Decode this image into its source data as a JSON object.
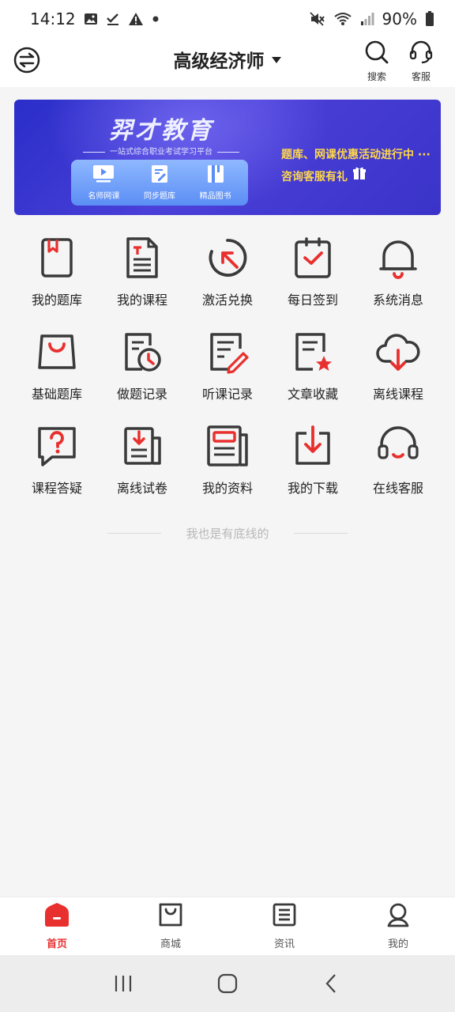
{
  "status_bar": {
    "time": "14:12",
    "battery": "90%",
    "icons": [
      "image-icon",
      "check-icon",
      "warning-icon",
      "dot-icon",
      "mute-icon",
      "wifi-icon",
      "signal-icon",
      "battery-icon"
    ]
  },
  "header": {
    "title": "高级经济师",
    "actions": [
      {
        "label": "搜索",
        "icon": "search-icon"
      },
      {
        "label": "客服",
        "icon": "headset-icon"
      }
    ]
  },
  "banner": {
    "brand": "羿才教育",
    "tagline": "一站式综合职业考试学习平台",
    "panel_items": [
      {
        "label": "名师网课",
        "icon": "video-icon"
      },
      {
        "label": "同步题库",
        "icon": "edit-icon"
      },
      {
        "label": "精品图书",
        "icon": "book-icon"
      }
    ],
    "promo_line1": "题库、网课优惠活动进行中 ···",
    "promo_line2": "咨询客服有礼"
  },
  "grid_items": [
    {
      "label": "我的题库",
      "icon": "question-bank-icon"
    },
    {
      "label": "我的课程",
      "icon": "course-doc-icon"
    },
    {
      "label": "激活兑换",
      "icon": "activate-icon"
    },
    {
      "label": "每日签到",
      "icon": "checkin-icon"
    },
    {
      "label": "系统消息",
      "icon": "bell-icon"
    },
    {
      "label": "基础题库",
      "icon": "bag-icon"
    },
    {
      "label": "做题记录",
      "icon": "practice-record-icon"
    },
    {
      "label": "听课记录",
      "icon": "lecture-record-icon"
    },
    {
      "label": "文章收藏",
      "icon": "article-star-icon"
    },
    {
      "label": "离线课程",
      "icon": "cloud-download-icon"
    },
    {
      "label": "课程答疑",
      "icon": "question-bubble-icon"
    },
    {
      "label": "离线试卷",
      "icon": "offline-paper-icon"
    },
    {
      "label": "我的资料",
      "icon": "materials-icon"
    },
    {
      "label": "我的下载",
      "icon": "download-icon"
    },
    {
      "label": "在线客服",
      "icon": "online-service-icon"
    }
  ],
  "footer_note": "我也是有底线的",
  "tabs": [
    {
      "label": "首页",
      "icon": "home-icon",
      "active": true
    },
    {
      "label": "商城",
      "icon": "shop-icon",
      "active": false
    },
    {
      "label": "资讯",
      "icon": "news-icon",
      "active": false
    },
    {
      "label": "我的",
      "icon": "profile-icon",
      "active": false
    }
  ],
  "colors": {
    "accent": "#e8302e",
    "icon_dark": "#3a3a3a",
    "banner_blue": "#3b34c9",
    "promo_yellow": "#ffd84a"
  }
}
